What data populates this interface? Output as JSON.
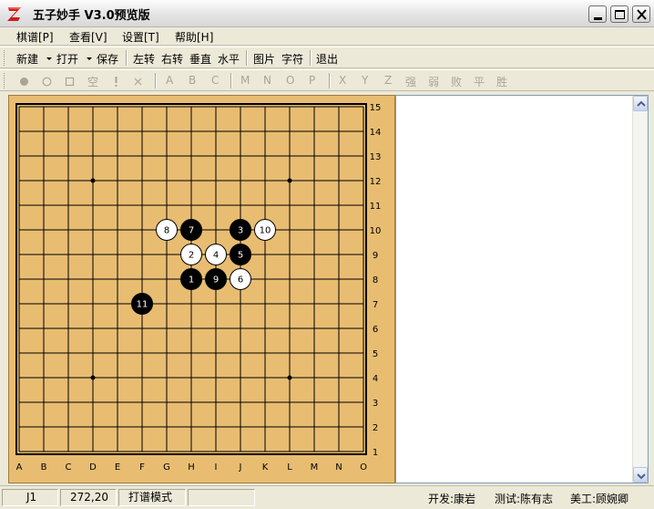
{
  "window": {
    "title": "五子妙手  V3.0预览版",
    "logo": "z-logo-icon",
    "buttons": [
      "minimize-icon",
      "maximize-icon",
      "close-icon"
    ]
  },
  "menu": [
    "棋谱[P]",
    "查看[V]",
    "设置[T]",
    "帮助[H]"
  ],
  "toolbar1": {
    "new": "新建",
    "open": "打开",
    "save": "保存",
    "rotate_left": "左转",
    "rotate_right": "右转",
    "vertical": "垂直",
    "horizontal": "水平",
    "image": "图片",
    "chars": "字符",
    "exit": "退出"
  },
  "toolbar2": {
    "mark_icons": [
      "black-stone-icon",
      "white-stone-icon",
      "square-icon"
    ],
    "empty": "空",
    "mark_icons2": [
      "exclamation-icon",
      "cross-icon"
    ],
    "letters": [
      "A",
      "B",
      "C",
      "M",
      "N",
      "O",
      "P",
      "X",
      "Y",
      "Z"
    ],
    "words": [
      "强",
      "弱",
      "败",
      "平",
      "胜"
    ]
  },
  "board": {
    "size": 15,
    "col_labels": [
      "A",
      "B",
      "C",
      "D",
      "E",
      "F",
      "G",
      "H",
      "I",
      "J",
      "K",
      "L",
      "M",
      "N",
      "O"
    ],
    "row_labels": [
      "15",
      "14",
      "13",
      "12",
      "11",
      "10",
      "9",
      "8",
      "7",
      "6",
      "5",
      "4",
      "3",
      "2",
      "1"
    ],
    "star_points": [
      "D12",
      "L12",
      "D4",
      "L4"
    ],
    "board_color": "#e8bd72",
    "moves": [
      {
        "n": 1,
        "color": "black",
        "pos": "H8"
      },
      {
        "n": 2,
        "color": "white",
        "pos": "H9"
      },
      {
        "n": 3,
        "color": "black",
        "pos": "J10"
      },
      {
        "n": 4,
        "color": "white",
        "pos": "I9"
      },
      {
        "n": 5,
        "color": "black",
        "pos": "J9"
      },
      {
        "n": 6,
        "color": "white",
        "pos": "J8"
      },
      {
        "n": 7,
        "color": "black",
        "pos": "H10"
      },
      {
        "n": 8,
        "color": "white",
        "pos": "G10"
      },
      {
        "n": 9,
        "color": "black",
        "pos": "I8"
      },
      {
        "n": 10,
        "color": "white",
        "pos": "K10"
      },
      {
        "n": 11,
        "color": "black",
        "pos": "F7"
      }
    ]
  },
  "status": {
    "position": "J1",
    "coords": "272,20",
    "mode": "打谱模式",
    "dev": "开发:康岩",
    "test": "测试:陈有志",
    "art": "美工:顾婉卿"
  }
}
